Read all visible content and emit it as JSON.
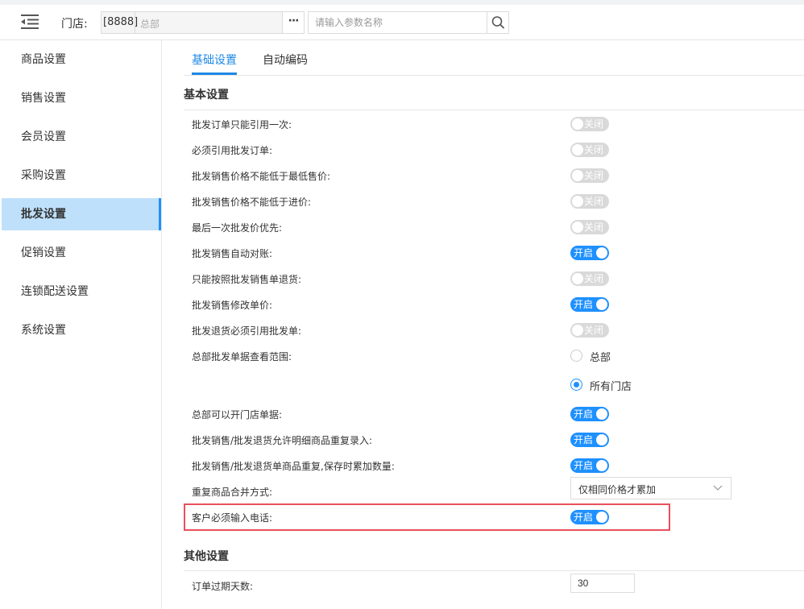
{
  "header": {
    "store_label": "门店:",
    "store_code": "[8888]",
    "store_name": "总部",
    "more_button": "···",
    "search_placeholder": "请输入参数名称",
    "icons": [
      "menu-collapse-icon",
      "search-icon"
    ]
  },
  "sidebar": {
    "items": [
      {
        "label": "商品设置"
      },
      {
        "label": "销售设置"
      },
      {
        "label": "会员设置"
      },
      {
        "label": "采购设置"
      },
      {
        "label": "批发设置",
        "active": true
      },
      {
        "label": "促销设置"
      },
      {
        "label": "连锁配送设置"
      },
      {
        "label": "系统设置"
      }
    ]
  },
  "tabs": [
    {
      "label": "基础设置",
      "active": true
    },
    {
      "label": "自动编码"
    }
  ],
  "basic": {
    "title": "基本设置",
    "rows": [
      {
        "label": "批发订单只能引用一次:",
        "state": "关闭"
      },
      {
        "label": "必须引用批发订单:",
        "state": "关闭"
      },
      {
        "label": "批发销售价格不能低于最低售价:",
        "state": "关闭"
      },
      {
        "label": "批发销售价格不能低于进价:",
        "state": "关闭"
      },
      {
        "label": "最后一次批发价优先:",
        "state": "关闭"
      },
      {
        "label": "批发销售自动对账:",
        "state": "开启"
      },
      {
        "label": "只能按照批发销售单退货:",
        "state": "关闭"
      },
      {
        "label": "批发销售修改单价:",
        "state": "开启"
      },
      {
        "label": "批发退货必须引用批发单:",
        "state": "关闭"
      }
    ],
    "scope": {
      "label": "总部批发单据查看范围:",
      "options": [
        {
          "label": "总部",
          "checked": false
        },
        {
          "label": "所有门店",
          "checked": true
        }
      ]
    },
    "rows2": [
      {
        "label": "总部可以开门店单据:",
        "state": "开启"
      },
      {
        "label": "批发销售/批发退货允许明细商品重复录入:",
        "state": "开启"
      },
      {
        "label": "批发销售/批发退货单商品重复,保存时累加数量:",
        "state": "开启"
      }
    ],
    "merge": {
      "label": "重复商品合并方式:",
      "value": "仅相同价格才累加"
    },
    "phone": {
      "label": "客户必须输入电话:",
      "state": "开启"
    }
  },
  "other": {
    "title": "其他设置",
    "expire_label": "订单过期天数:",
    "expire_value": "30"
  },
  "colors": {
    "accent": "#1e90ff",
    "sidebar_active_bg": "#bfe0fb",
    "switch_off": "#d9d9d9",
    "highlight_border": "#e8505b"
  }
}
